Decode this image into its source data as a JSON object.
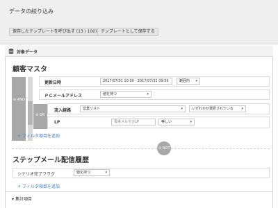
{
  "header": {
    "title": "データの絞り込み",
    "load_template_label": "保存したテンプレートを呼び出す (13 / 100)",
    "save_template_label": "テンプレートとして保存する"
  },
  "section": {
    "label": "対象データ",
    "icon": "database-icon"
  },
  "group1": {
    "title": "顧客マスタ",
    "and_label": "AND",
    "or_label": "OR",
    "rows": {
      "updated": {
        "label": "更新日時",
        "date_range": "2017/07/01 10:00 - 2017/07/31 09:59",
        "condition": "範囲内"
      },
      "pc_email": {
        "label": "ＰＣメールアドレス",
        "condition": "値を持つ"
      },
      "inflow": {
        "label": "流入経路",
        "value": "営業リスト",
        "condition": "いずれかが選択されている"
      },
      "lp": {
        "label": "LP",
        "placeholder": "母舟メルマガLP",
        "condition": "等しい"
      }
    },
    "add_filter_label": "フィルタ項目を追加"
  },
  "not_label": "NOT",
  "group2": {
    "title": "ステップメール配信履歴",
    "rows": {
      "scenario": {
        "label": "シナリオ完了フラグ",
        "condition": "値を持つ"
      }
    },
    "add_filter_label": "フィルタ項目を追加"
  },
  "aggregate_label": "集計項目",
  "colors": {
    "link": "#3b78c8",
    "connector": "#a8a8a8",
    "band": "#efefef"
  }
}
